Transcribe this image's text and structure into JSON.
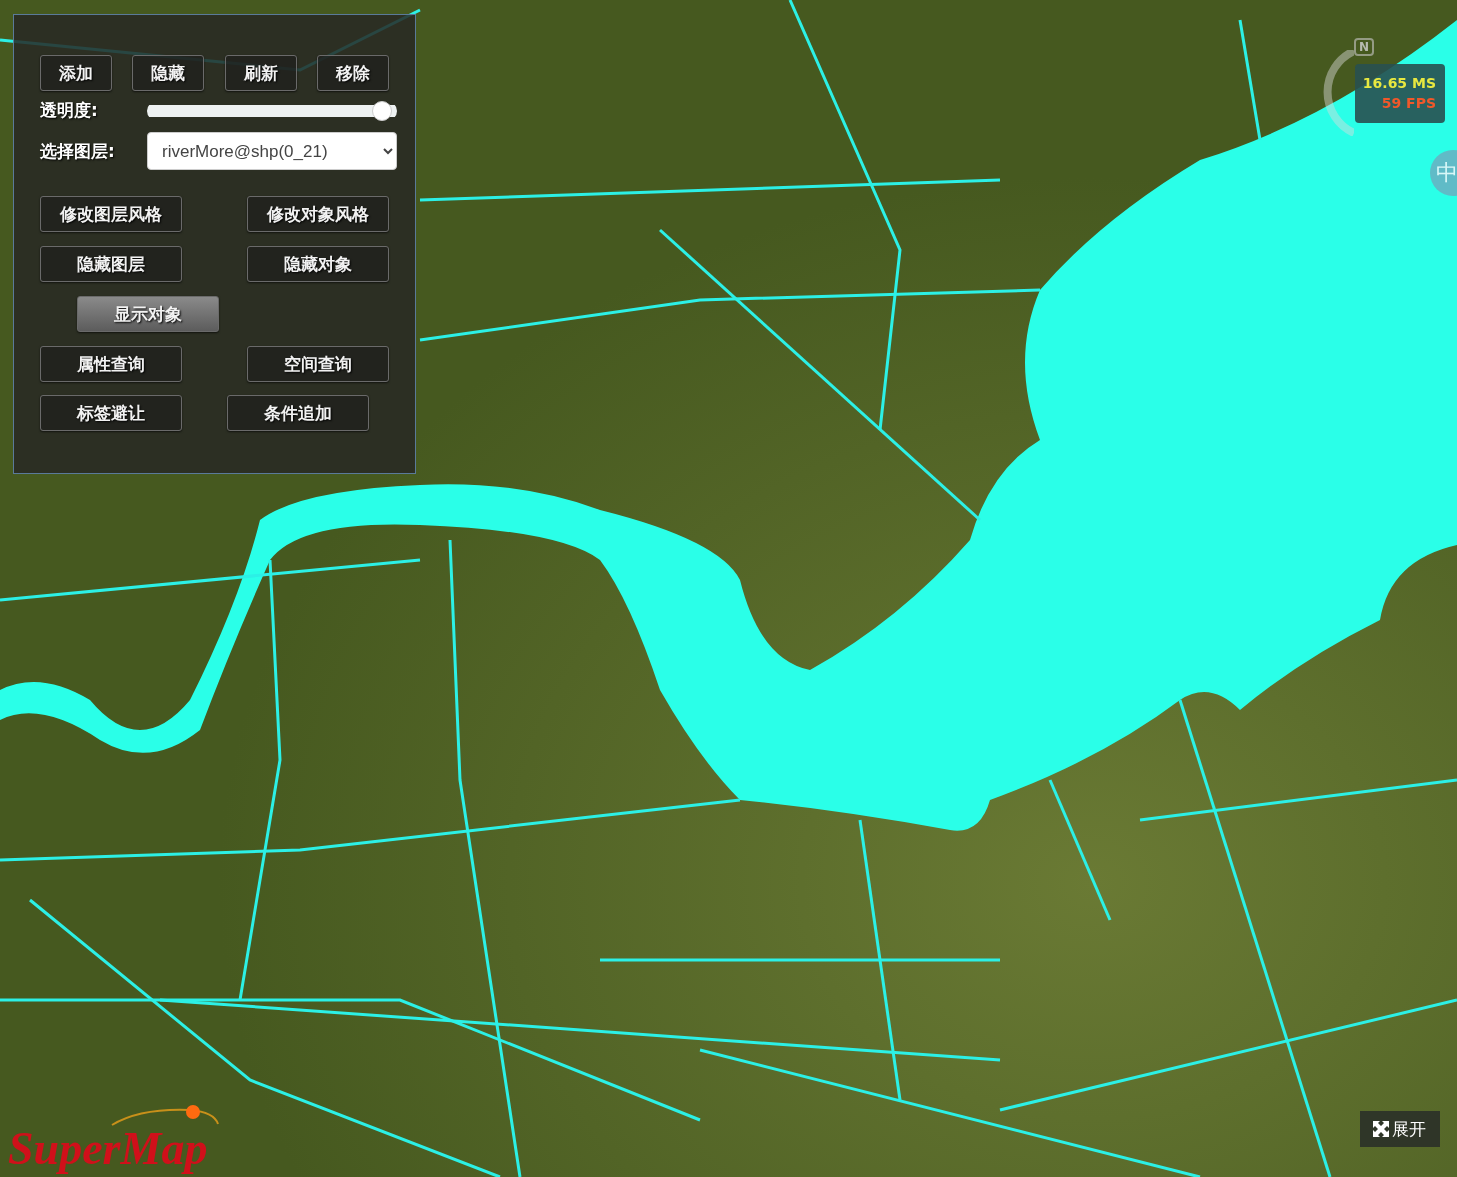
{
  "panel": {
    "top_buttons": [
      "添加",
      "隐藏",
      "刷新",
      "移除"
    ],
    "opacity": {
      "label": "透明度:",
      "level": 0.98
    },
    "layer_select": {
      "label": "选择图层:",
      "value": "riverMore@shp(0_21)"
    },
    "button_rows": [
      [
        {
          "label": "修改图层风格",
          "selected": false
        },
        {
          "label": "修改对象风格",
          "selected": false
        }
      ],
      [
        {
          "label": "隐藏图层",
          "selected": false
        },
        {
          "label": "隐藏对象",
          "selected": false
        }
      ],
      [
        {
          "label": "显示对象",
          "selected": true
        }
      ],
      [
        {
          "label": "属性查询",
          "selected": false
        },
        {
          "label": "空间查询",
          "selected": false
        }
      ],
      [
        {
          "label": "标签避让",
          "selected": false
        },
        {
          "label": "条件追加",
          "selected": false
        }
      ]
    ]
  },
  "compass": {
    "north": "N"
  },
  "stats": {
    "ms": "16.65 MS",
    "fps": "59 FPS"
  },
  "side_badge": "中",
  "logo": "SuperMap",
  "expand_button": "展开"
}
